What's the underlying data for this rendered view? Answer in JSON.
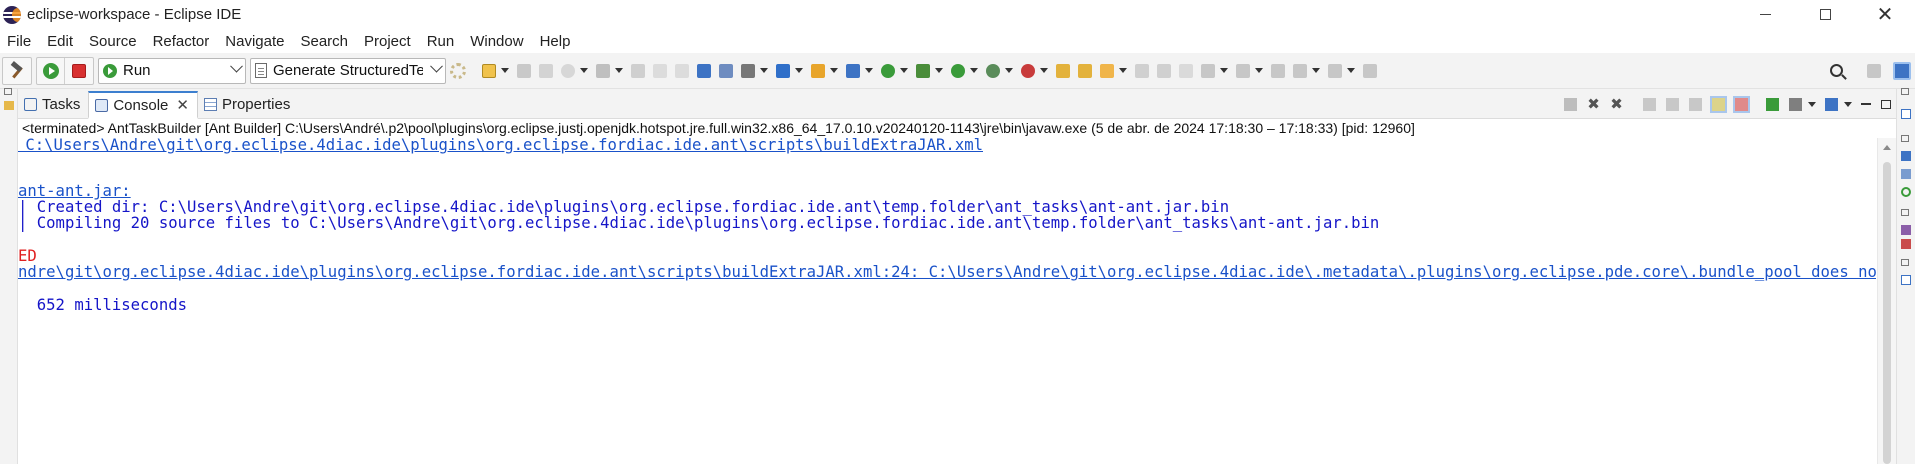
{
  "window": {
    "title": "eclipse-workspace - Eclipse IDE"
  },
  "menu": [
    "File",
    "Edit",
    "Source",
    "Refactor",
    "Navigate",
    "Search",
    "Project",
    "Run",
    "Window",
    "Help"
  ],
  "toolbar": {
    "run_config_label": "Run",
    "launch_target_label": "Generate StructuredText Lar"
  },
  "view_tabs": [
    {
      "label": "Tasks",
      "icon": "tasks-icon"
    },
    {
      "label": "Console",
      "icon": "console-icon",
      "active": true
    },
    {
      "label": "Properties",
      "icon": "properties-icon"
    }
  ],
  "console": {
    "status": "<terminated> AntTaskBuilder [Ant Builder] C:\\Users\\André\\.p2\\pool\\plugins\\org.eclipse.justj.openjdk.hotspot.jre.full.win32.x86_64_17.0.10.v20240120-1143\\jre\\bin\\javaw.exe  (5 de abr. de 2024 17:18:30 – 17:18:33) [pid: 12960]",
    "lines": [
      {
        "text": " C:\\Users\\Andre\\git\\org.eclipse.4diac.ide\\plugins\\org.eclipse.fordiac.ide.ant\\scripts\\buildExtraJAR.xml",
        "style": "link"
      },
      {
        "text": "ant-ant.jar:",
        "style": "link"
      },
      {
        "text": "| Created dir: C:\\Users\\Andre\\git\\org.eclipse.4diac.ide\\plugins\\org.eclipse.fordiac.ide.ant\\temp.folder\\ant_tasks\\ant-ant.jar.bin",
        "style": "blue"
      },
      {
        "text": "| Compiling 20 source files to C:\\Users\\Andre\\git\\org.eclipse.4diac.ide\\plugins\\org.eclipse.fordiac.ide.ant\\temp.folder\\ant_tasks\\ant-ant.jar.bin",
        "style": "blue"
      },
      {
        "text": "ED",
        "style": "red"
      },
      {
        "text": "ndre\\git\\org.eclipse.4diac.ide\\plugins\\org.eclipse.fordiac.ide.ant\\scripts\\buildExtraJAR.xml:24: C:\\Users\\Andre\\git\\org.eclipse.4diac.ide\\.metadata\\.plugins\\org.eclipse.pde.core\\.bundle_pool does not exist.",
        "style": "link"
      },
      {
        "text": "  652 milliseconds",
        "style": "blue"
      }
    ]
  },
  "colors": {
    "link": "#1a52c9",
    "stdout": "#1515c8",
    "error": "#e02020",
    "active_tab_accent": "#3c7fcf"
  }
}
